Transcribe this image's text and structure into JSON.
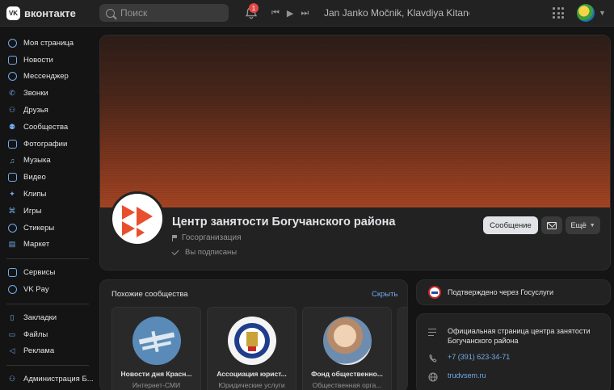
{
  "topbar": {
    "logo_mark": "VK",
    "logo_text": "вконтакте",
    "search_placeholder": "Поиск",
    "notifications_count": "1",
    "now_playing": "Jan Janko Močnik, Klavdiya Kitanova — ..."
  },
  "sidebar": {
    "items": [
      {
        "label": "Моя страница",
        "icon": "user-icon"
      },
      {
        "label": "Новости",
        "icon": "news-icon"
      },
      {
        "label": "Мессенджер",
        "icon": "message-icon"
      },
      {
        "label": "Звонки",
        "icon": "phone-icon"
      },
      {
        "label": "Друзья",
        "icon": "friends-icon"
      },
      {
        "label": "Сообщества",
        "icon": "communities-icon"
      },
      {
        "label": "Фотографии",
        "icon": "photo-icon"
      },
      {
        "label": "Музыка",
        "icon": "music-icon"
      },
      {
        "label": "Видео",
        "icon": "video-icon"
      },
      {
        "label": "Клипы",
        "icon": "clips-icon"
      },
      {
        "label": "Игры",
        "icon": "gamepad-icon"
      },
      {
        "label": "Стикеры",
        "icon": "sticker-icon"
      },
      {
        "label": "Маркет",
        "icon": "market-icon"
      }
    ],
    "items2": [
      {
        "label": "Сервисы",
        "icon": "services-icon"
      },
      {
        "label": "VK Pay",
        "icon": "vkpay-icon"
      }
    ],
    "items3": [
      {
        "label": "Закладки",
        "icon": "bookmark-icon"
      },
      {
        "label": "Файлы",
        "icon": "file-icon"
      },
      {
        "label": "Реклама",
        "icon": "megaphone-icon"
      }
    ],
    "items4": [
      {
        "label": "Администрация Б...",
        "icon": "admin-icon"
      }
    ]
  },
  "profile": {
    "title": "Центр занятости Богучанского района",
    "category": "Госорганизация",
    "subscribed": "Вы подписаны",
    "message_button": "Сообщение",
    "more_button": "Ещё"
  },
  "similar": {
    "title": "Похожие сообщества",
    "hide": "Скрыть",
    "cards": [
      {
        "name": "Новости дня Красн...",
        "type": "Интернет-СМИ"
      },
      {
        "name": "Ассоциация юрист...",
        "type": "Юридические услуги"
      },
      {
        "name": "Фонд общественно...",
        "type": "Общественная орга..."
      }
    ]
  },
  "verified": {
    "text": "Подтверждено через Госуслуги"
  },
  "info": {
    "description": "Официальная страница центра занятости Богучанского района",
    "phone": "+7 (391) 623-34-71",
    "website": "trudvsem.ru"
  },
  "colors": {
    "accent": "#71aaeb",
    "background": "#141414",
    "card": "#222222",
    "cover_bottom": "#a34423"
  }
}
